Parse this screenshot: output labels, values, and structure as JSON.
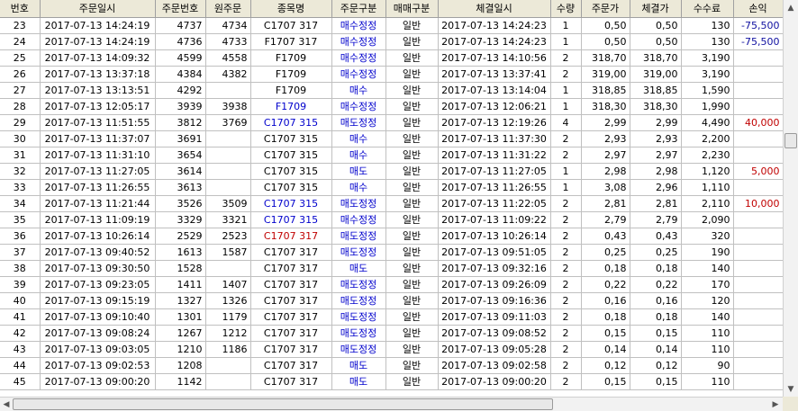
{
  "columns": [
    "번호",
    "주문일시",
    "주문번호",
    "원주문",
    "종목명",
    "주문구분",
    "매매구분",
    "체결일시",
    "수량",
    "주문가",
    "체결가",
    "수수료",
    "손익"
  ],
  "rows": [
    {
      "no": "23",
      "order_time": "2017-07-13 14:24:19",
      "order_no": "4737",
      "orig": "4734",
      "item": "C1707 317",
      "type": "매수정정",
      "trade": "일반",
      "fill_time": "2017-07-13 14:24:23",
      "qty": "1",
      "price": "0,50",
      "fill_price": "0,50",
      "fee": "130",
      "pnl": "-75,500",
      "item_color": "black",
      "pnl_color": "blue"
    },
    {
      "no": "24",
      "order_time": "2017-07-13 14:24:19",
      "order_no": "4736",
      "orig": "4733",
      "item": "F1707 317",
      "type": "매수정정",
      "trade": "일반",
      "fill_time": "2017-07-13 14:24:23",
      "qty": "1",
      "price": "0,50",
      "fill_price": "0,50",
      "fee": "130",
      "pnl": "-75,500",
      "item_color": "black",
      "pnl_color": "blue"
    },
    {
      "no": "25",
      "order_time": "2017-07-13 14:09:32",
      "order_no": "4599",
      "orig": "4558",
      "item": "F1709",
      "type": "매수정정",
      "trade": "일반",
      "fill_time": "2017-07-13 14:10:56",
      "qty": "2",
      "price": "318,70",
      "fill_price": "318,70",
      "fee": "3,190",
      "pnl": "",
      "item_color": "black",
      "pnl_color": "black"
    },
    {
      "no": "26",
      "order_time": "2017-07-13 13:37:18",
      "order_no": "4384",
      "orig": "4382",
      "item": "F1709",
      "type": "매수정정",
      "trade": "일반",
      "fill_time": "2017-07-13 13:37:41",
      "qty": "2",
      "price": "319,00",
      "fill_price": "319,00",
      "fee": "3,190",
      "pnl": "",
      "item_color": "black",
      "pnl_color": "black"
    },
    {
      "no": "27",
      "order_time": "2017-07-13 13:13:51",
      "order_no": "4292",
      "orig": "",
      "item": "F1709",
      "type": "매수",
      "trade": "일반",
      "fill_time": "2017-07-13 13:14:04",
      "qty": "1",
      "price": "318,85",
      "fill_price": "318,85",
      "fee": "1,590",
      "pnl": "",
      "item_color": "black",
      "pnl_color": "black"
    },
    {
      "no": "28",
      "order_time": "2017-07-13 12:05:17",
      "order_no": "3939",
      "orig": "3938",
      "item": "F1709",
      "type": "매수정정",
      "trade": "일반",
      "fill_time": "2017-07-13 12:06:21",
      "qty": "1",
      "price": "318,30",
      "fill_price": "318,30",
      "fee": "1,990",
      "pnl": "",
      "item_color": "blue",
      "pnl_color": "black"
    },
    {
      "no": "29",
      "order_time": "2017-07-13 11:51:55",
      "order_no": "3812",
      "orig": "3769",
      "item": "C1707 315",
      "type": "매도정정",
      "trade": "일반",
      "fill_time": "2017-07-13 12:19:26",
      "qty": "4",
      "price": "2,99",
      "fill_price": "2,99",
      "fee": "4,490",
      "pnl": "40,000",
      "item_color": "blue",
      "pnl_color": "red"
    },
    {
      "no": "30",
      "order_time": "2017-07-13 11:37:07",
      "order_no": "3691",
      "orig": "",
      "item": "C1707 315",
      "type": "매수",
      "trade": "일반",
      "fill_time": "2017-07-13 11:37:30",
      "qty": "2",
      "price": "2,93",
      "fill_price": "2,93",
      "fee": "2,200",
      "pnl": "",
      "item_color": "black",
      "pnl_color": "black"
    },
    {
      "no": "31",
      "order_time": "2017-07-13 11:31:10",
      "order_no": "3654",
      "orig": "",
      "item": "C1707 315",
      "type": "매수",
      "trade": "일반",
      "fill_time": "2017-07-13 11:31:22",
      "qty": "2",
      "price": "2,97",
      "fill_price": "2,97",
      "fee": "2,230",
      "pnl": "",
      "item_color": "black",
      "pnl_color": "black"
    },
    {
      "no": "32",
      "order_time": "2017-07-13 11:27:05",
      "order_no": "3614",
      "orig": "",
      "item": "C1707 315",
      "type": "매도",
      "trade": "일반",
      "fill_time": "2017-07-13 11:27:05",
      "qty": "1",
      "price": "2,98",
      "fill_price": "2,98",
      "fee": "1,120",
      "pnl": "5,000",
      "item_color": "black",
      "pnl_color": "red"
    },
    {
      "no": "33",
      "order_time": "2017-07-13 11:26:55",
      "order_no": "3613",
      "orig": "",
      "item": "C1707 315",
      "type": "매수",
      "trade": "일반",
      "fill_time": "2017-07-13 11:26:55",
      "qty": "1",
      "price": "3,08",
      "fill_price": "2,96",
      "fee": "1,110",
      "pnl": "",
      "item_color": "black",
      "pnl_color": "black"
    },
    {
      "no": "34",
      "order_time": "2017-07-13 11:21:44",
      "order_no": "3526",
      "orig": "3509",
      "item": "C1707 315",
      "type": "매도정정",
      "trade": "일반",
      "fill_time": "2017-07-13 11:22:05",
      "qty": "2",
      "price": "2,81",
      "fill_price": "2,81",
      "fee": "2,110",
      "pnl": "10,000",
      "item_color": "blue",
      "pnl_color": "red"
    },
    {
      "no": "35",
      "order_time": "2017-07-13 11:09:19",
      "order_no": "3329",
      "orig": "3321",
      "item": "C1707 315",
      "type": "매수정정",
      "trade": "일반",
      "fill_time": "2017-07-13 11:09:22",
      "qty": "2",
      "price": "2,79",
      "fill_price": "2,79",
      "fee": "2,090",
      "pnl": "",
      "item_color": "blue",
      "pnl_color": "black"
    },
    {
      "no": "36",
      "order_time": "2017-07-13 10:26:14",
      "order_no": "2529",
      "orig": "2523",
      "item": "C1707 317",
      "type": "매도정정",
      "trade": "일반",
      "fill_time": "2017-07-13 10:26:14",
      "qty": "2",
      "price": "0,43",
      "fill_price": "0,43",
      "fee": "320",
      "pnl": "",
      "item_color": "red",
      "pnl_color": "black"
    },
    {
      "no": "37",
      "order_time": "2017-07-13 09:40:52",
      "order_no": "1613",
      "orig": "1587",
      "item": "C1707 317",
      "type": "매도정정",
      "trade": "일반",
      "fill_time": "2017-07-13 09:51:05",
      "qty": "2",
      "price": "0,25",
      "fill_price": "0,25",
      "fee": "190",
      "pnl": "",
      "item_color": "black",
      "pnl_color": "black"
    },
    {
      "no": "38",
      "order_time": "2017-07-13 09:30:50",
      "order_no": "1528",
      "orig": "",
      "item": "C1707 317",
      "type": "매도",
      "trade": "일반",
      "fill_time": "2017-07-13 09:32:16",
      "qty": "2",
      "price": "0,18",
      "fill_price": "0,18",
      "fee": "140",
      "pnl": "",
      "item_color": "black",
      "pnl_color": "black"
    },
    {
      "no": "39",
      "order_time": "2017-07-13 09:23:05",
      "order_no": "1411",
      "orig": "1407",
      "item": "C1707 317",
      "type": "매도정정",
      "trade": "일반",
      "fill_time": "2017-07-13 09:26:09",
      "qty": "2",
      "price": "0,22",
      "fill_price": "0,22",
      "fee": "170",
      "pnl": "",
      "item_color": "black",
      "pnl_color": "black"
    },
    {
      "no": "40",
      "order_time": "2017-07-13 09:15:19",
      "order_no": "1327",
      "orig": "1326",
      "item": "C1707 317",
      "type": "매도정정",
      "trade": "일반",
      "fill_time": "2017-07-13 09:16:36",
      "qty": "2",
      "price": "0,16",
      "fill_price": "0,16",
      "fee": "120",
      "pnl": "",
      "item_color": "black",
      "pnl_color": "black"
    },
    {
      "no": "41",
      "order_time": "2017-07-13 09:10:40",
      "order_no": "1301",
      "orig": "1179",
      "item": "C1707 317",
      "type": "매도정정",
      "trade": "일반",
      "fill_time": "2017-07-13 09:11:03",
      "qty": "2",
      "price": "0,18",
      "fill_price": "0,18",
      "fee": "140",
      "pnl": "",
      "item_color": "black",
      "pnl_color": "black"
    },
    {
      "no": "42",
      "order_time": "2017-07-13 09:08:24",
      "order_no": "1267",
      "orig": "1212",
      "item": "C1707 317",
      "type": "매도정정",
      "trade": "일반",
      "fill_time": "2017-07-13 09:08:52",
      "qty": "2",
      "price": "0,15",
      "fill_price": "0,15",
      "fee": "110",
      "pnl": "",
      "item_color": "black",
      "pnl_color": "black"
    },
    {
      "no": "43",
      "order_time": "2017-07-13 09:03:05",
      "order_no": "1210",
      "orig": "1186",
      "item": "C1707 317",
      "type": "매도정정",
      "trade": "일반",
      "fill_time": "2017-07-13 09:05:28",
      "qty": "2",
      "price": "0,14",
      "fill_price": "0,14",
      "fee": "110",
      "pnl": "",
      "item_color": "black",
      "pnl_color": "black"
    },
    {
      "no": "44",
      "order_time": "2017-07-13 09:02:53",
      "order_no": "1208",
      "orig": "",
      "item": "C1707 317",
      "type": "매도",
      "trade": "일반",
      "fill_time": "2017-07-13 09:02:58",
      "qty": "2",
      "price": "0,12",
      "fill_price": "0,12",
      "fee": "90",
      "pnl": "",
      "item_color": "black",
      "pnl_color": "black"
    },
    {
      "no": "45",
      "order_time": "2017-07-13 09:00:20",
      "order_no": "1142",
      "orig": "",
      "item": "C1707 317",
      "type": "매도",
      "trade": "일반",
      "fill_time": "2017-07-13 09:00:20",
      "qty": "2",
      "price": "0,15",
      "fill_price": "0,15",
      "fee": "110",
      "pnl": "",
      "item_color": "black",
      "pnl_color": "black"
    }
  ],
  "scrollbar": {
    "up_icon": "arrow-up-icon",
    "down_icon": "arrow-down-icon",
    "left_icon": "arrow-left-icon",
    "right_icon": "arrow-right-icon"
  },
  "colors": {
    "header_bg": "#ece9d8",
    "grid_line": "#c0c0c0",
    "blue_text": "#1010a0",
    "red_text": "#c00000"
  }
}
